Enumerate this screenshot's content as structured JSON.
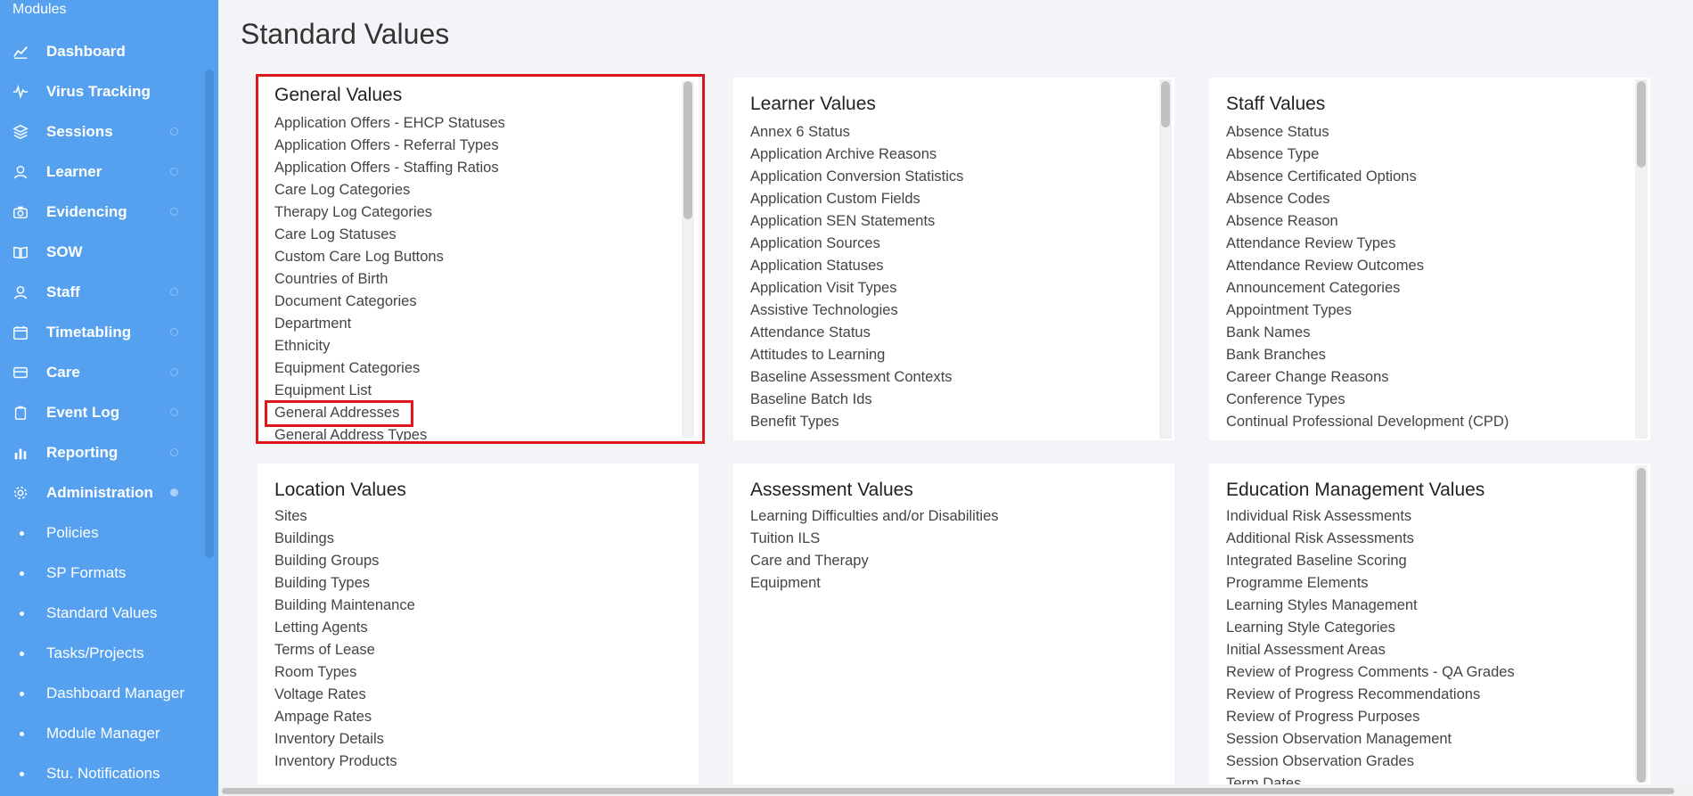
{
  "sidebar": {
    "modules_label": "Modules",
    "items": [
      {
        "label": "Dashboard",
        "icon": "chart-line-icon",
        "expandable": false
      },
      {
        "label": "Virus Tracking",
        "icon": "pulse-icon",
        "expandable": false
      },
      {
        "label": "Sessions",
        "icon": "layers-icon",
        "expandable": true
      },
      {
        "label": "Learner",
        "icon": "person-icon",
        "expandable": true
      },
      {
        "label": "Evidencing",
        "icon": "camera-icon",
        "expandable": true
      },
      {
        "label": "SOW",
        "icon": "book-icon",
        "expandable": false
      },
      {
        "label": "Staff",
        "icon": "person-icon",
        "expandable": true
      },
      {
        "label": "Timetabling",
        "icon": "calendar-icon",
        "expandable": true
      },
      {
        "label": "Care",
        "icon": "card-icon",
        "expandable": true
      },
      {
        "label": "Event Log",
        "icon": "clipboard-icon",
        "expandable": true
      },
      {
        "label": "Reporting",
        "icon": "bar-chart-icon",
        "expandable": true
      },
      {
        "label": "Administration",
        "icon": "gear-icon",
        "expandable": true,
        "expanded": true
      }
    ],
    "sub_items": [
      {
        "label": "Policies"
      },
      {
        "label": "SP Formats"
      },
      {
        "label": "Standard Values"
      },
      {
        "label": "Tasks/Projects"
      },
      {
        "label": "Dashboard Manager"
      },
      {
        "label": "Module Manager"
      },
      {
        "label": "Stu. Notifications"
      }
    ]
  },
  "main": {
    "title": "Standard Values",
    "cards": [
      {
        "title": "General Values",
        "items": [
          "Application Offers - EHCP Statuses",
          "Application Offers - Referral Types",
          "Application Offers - Staffing Ratios",
          "Care Log Categories",
          "Therapy Log Categories",
          "Care Log Statuses",
          "Custom Care Log Buttons",
          "Countries of Birth",
          "Document Categories",
          "Department",
          "Ethnicity",
          "Equipment Categories",
          "Equipment List",
          "General Addresses",
          "General Address Types"
        ]
      },
      {
        "title": "Learner Values",
        "items": [
          "Annex 6 Status",
          "Application Archive Reasons",
          "Application Conversion Statistics",
          "Application Custom Fields",
          "Application SEN Statements",
          "Application Sources",
          "Application Statuses",
          "Application Visit Types",
          "Assistive Technologies",
          "Attendance Status",
          "Attitudes to Learning",
          "Baseline Assessment Contexts",
          "Baseline Batch Ids",
          "Benefit Types"
        ]
      },
      {
        "title": "Staff Values",
        "items": [
          "Absence Status",
          "Absence Type",
          "Absence Certificated Options",
          "Absence Codes",
          "Absence Reason",
          "Attendance Review Types",
          "Attendance Review Outcomes",
          "Announcement Categories",
          "Appointment Types",
          "Bank Names",
          "Bank Branches",
          "Career Change Reasons",
          "Conference Types",
          "Continual Professional Development (CPD)"
        ]
      },
      {
        "title": "Location Values",
        "items": [
          "Sites",
          "Buildings",
          "Building Groups",
          "Building Types",
          "Building Maintenance",
          "Letting Agents",
          "Terms of Lease",
          "Room Types",
          "Voltage Rates",
          "Ampage Rates",
          "Inventory Details",
          "Inventory Products"
        ]
      },
      {
        "title": "Assessment Values",
        "items": [
          "Learning Difficulties and/or Disabilities",
          "Tuition ILS",
          "Care and Therapy",
          "Equipment"
        ]
      },
      {
        "title": "Education Management Values",
        "items": [
          "Individual Risk Assessments",
          "Additional Risk Assessments",
          "Integrated Baseline Scoring",
          "Programme Elements",
          "Learning Styles Management",
          "Learning Style Categories",
          "Initial Assessment Areas",
          "Review of Progress Comments - QA Grades",
          "Review of Progress Recommendations",
          "Review of Progress Purposes",
          "Session Observation Management",
          "Session Observation Grades",
          "Term Dates"
        ]
      }
    ]
  },
  "colors": {
    "sidebar_bg": "#55a1ef",
    "highlight": "#e0161d",
    "page_bg": "#f3f4f8"
  }
}
